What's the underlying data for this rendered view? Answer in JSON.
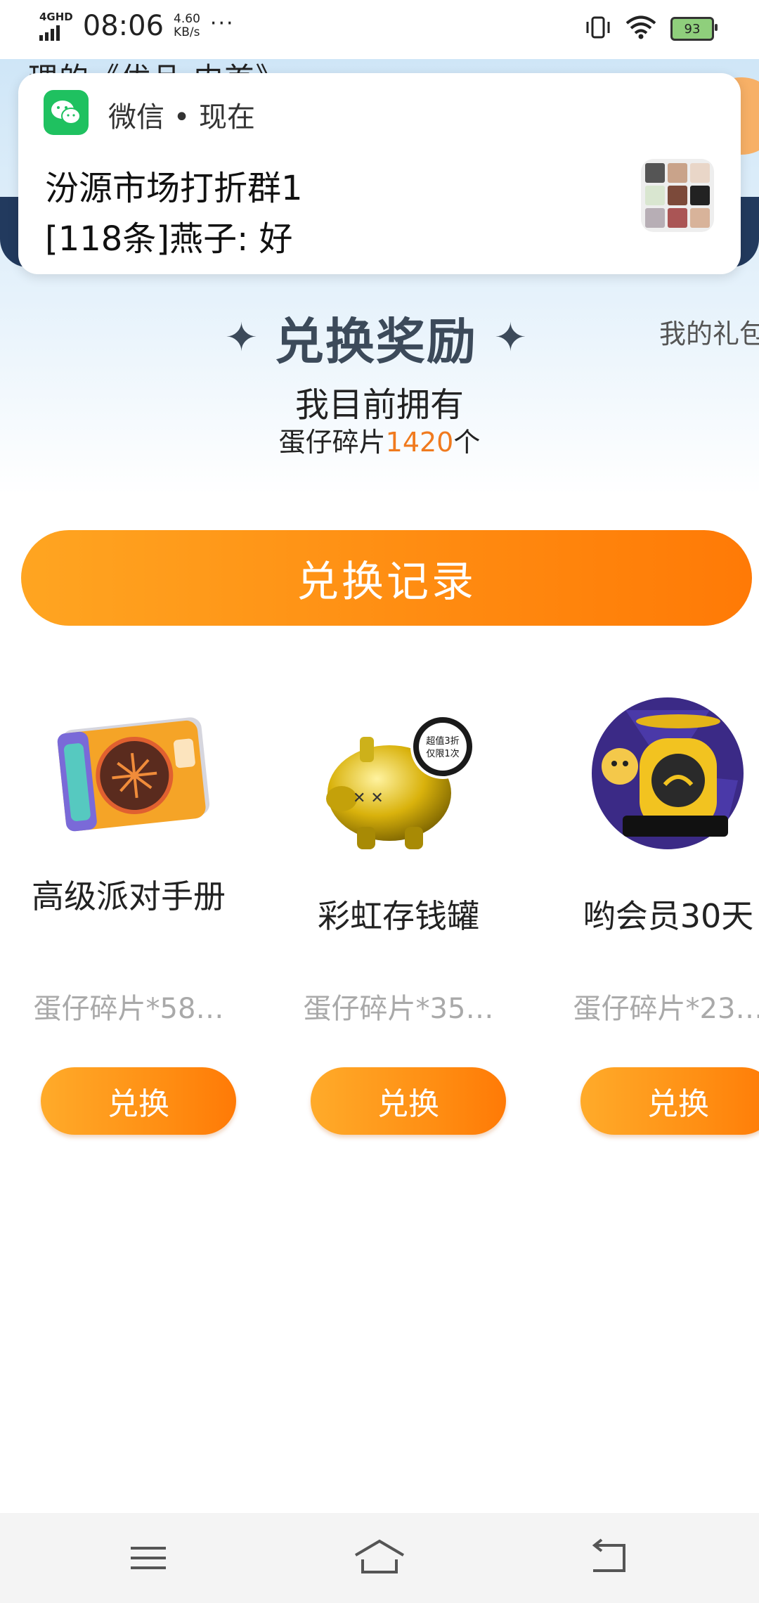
{
  "status_bar": {
    "network_type": "4GHD",
    "time": "08:06",
    "speed_value": "4.60",
    "speed_unit": "KB/s",
    "more": "···",
    "battery": "93",
    "icons": [
      "vibrate-icon",
      "wifi-icon",
      "battery-icon"
    ]
  },
  "notification": {
    "app_name": "微信",
    "separator": "•",
    "when": "现在",
    "title": "汾源市场打折群1",
    "message": "[118条]燕子: 好",
    "icon": "wechat-icon"
  },
  "header": {
    "title_peek": "理的《优品·内首》",
    "title": "兑换奖励",
    "my_gifts_link": "我的礼包",
    "own_label": "我目前拥有",
    "own_prefix": "蛋仔碎片",
    "own_count": "1420",
    "own_suffix": "个"
  },
  "records_button": {
    "label": "兑换记录"
  },
  "items": [
    {
      "name": "高级派对手册",
      "cost": "蛋仔碎片*58…",
      "button": "兑换",
      "icon": "party-handbook-icon"
    },
    {
      "name": "彩虹存钱罐",
      "cost": "蛋仔碎片*35…",
      "button": "兑换",
      "icon": "piggy-bank-icon"
    },
    {
      "name": "哟会员30天",
      "cost": "蛋仔碎片*23…",
      "button": "兑换",
      "icon": "membership-icon"
    }
  ],
  "item_badge": {
    "line1": "超值3折",
    "line2": "仅限1次"
  },
  "nav": {
    "icons": [
      "menu-icon",
      "home-icon",
      "back-icon"
    ]
  },
  "colors": {
    "accent_orange": "#ff8a10",
    "count_orange": "#f07a1e",
    "wechat_green": "#1fc160",
    "header_navy": "#223a5e"
  }
}
